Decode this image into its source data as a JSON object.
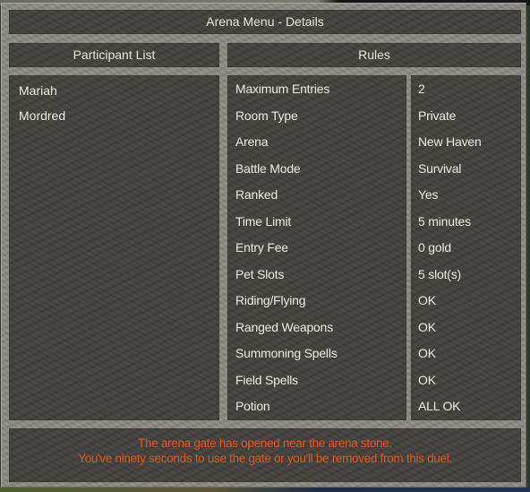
{
  "window": {
    "title": "Arena Menu - Details"
  },
  "headers": {
    "participants": "Participant List",
    "rules": "Rules"
  },
  "participants": [
    {
      "name": "Mariah"
    },
    {
      "name": "Mordred"
    }
  ],
  "rules": [
    {
      "label": "Maximum Entries",
      "value": "2"
    },
    {
      "label": "Room Type",
      "value": "Private"
    },
    {
      "label": "Arena",
      "value": "New Haven"
    },
    {
      "label": "Battle Mode",
      "value": "Survival"
    },
    {
      "label": "Ranked",
      "value": "Yes"
    },
    {
      "label": "Time Limit",
      "value": "5 minutes"
    },
    {
      "label": "Entry Fee",
      "value": "0 gold"
    },
    {
      "label": "Pet Slots",
      "value": "5 slot(s)"
    },
    {
      "label": "Riding/Flying",
      "value": "OK"
    },
    {
      "label": "Ranged Weapons",
      "value": "OK"
    },
    {
      "label": "Summoning Spells",
      "value": "OK"
    },
    {
      "label": "Field Spells",
      "value": "OK"
    },
    {
      "label": "Potion",
      "value": "ALL OK"
    }
  ],
  "message": {
    "line1": "The arena gate has opened near the arena stone.",
    "line2": "You've ninety seconds to use the gate or you'll be removed from this duel.",
    "color": "#e2541d"
  },
  "colors": {
    "frame": "#8b8a84",
    "panel": "#43413d",
    "text": "#e8e6df"
  }
}
